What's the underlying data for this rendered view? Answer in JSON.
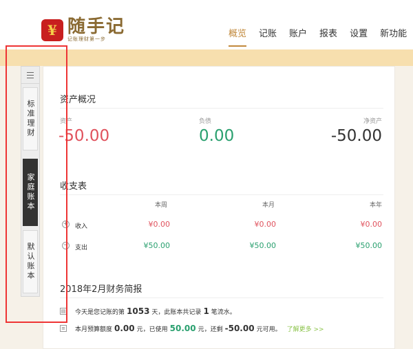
{
  "header": {
    "logo_mark": "¥",
    "logo_title": "随手记",
    "logo_subtitle": "记账理财第一步",
    "nav": [
      "概览",
      "记账",
      "账户",
      "报表",
      "设置",
      "新功能"
    ]
  },
  "sidebar": {
    "books": [
      "标准理财",
      "家庭账本",
      "默认账本"
    ],
    "active_index": 1
  },
  "assets": {
    "title": "资产概况",
    "asset_label": "资产",
    "asset_value": "-50.00",
    "liability_label": "负债",
    "liability_value": "0.00",
    "net_label": "净资产",
    "net_value": "-50.00"
  },
  "income_expense": {
    "title": "收支表",
    "columns": [
      "本周",
      "本月",
      "本年"
    ],
    "rows": [
      {
        "label": "收入",
        "icon": "+",
        "values": [
          "¥0.00",
          "¥0.00",
          "¥0.00"
        ]
      },
      {
        "label": "支出",
        "icon": "−",
        "values": [
          "¥50.00",
          "¥50.00",
          "¥50.00"
        ]
      }
    ]
  },
  "report": {
    "title": "2018年2月财务简报",
    "line1": {
      "text_a": "今天是您记账的第",
      "days": "1053",
      "text_b": "天，此账本共记录",
      "records": "1",
      "text_c": "笔流水。"
    },
    "line2": {
      "text_a": "本月预算额度",
      "budget": "0.00",
      "text_b": "元，已使用",
      "used": "50.00",
      "text_c": "元，还剩",
      "remaining": "-50.00",
      "text_d": "元可用。",
      "link": "了解更多 >>"
    }
  },
  "colors": {
    "accent": "#c1883b",
    "negative": "#e0525d",
    "positive": "#2aa06f",
    "highlight_frame": "#ee3333"
  }
}
